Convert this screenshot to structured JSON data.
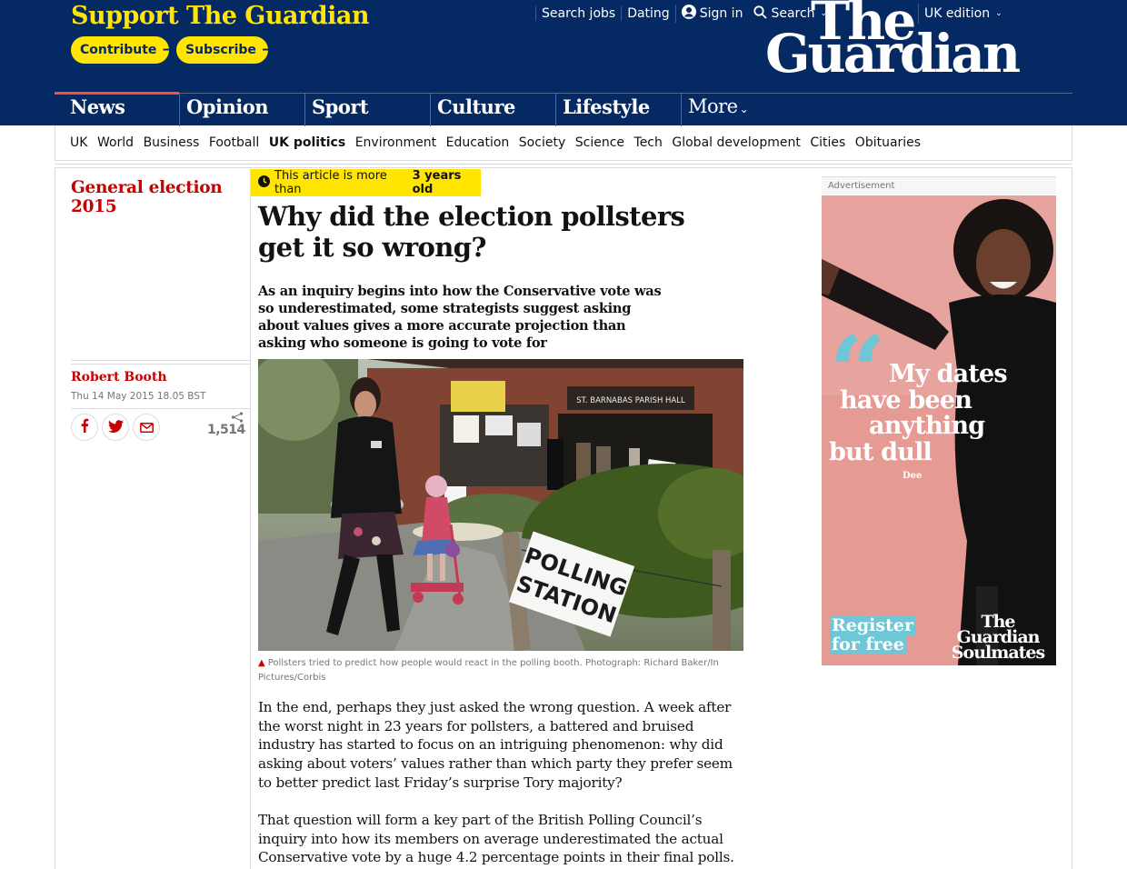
{
  "header": {
    "support_title": "Support The Guardian",
    "contribute_label": "Contribute",
    "subscribe_label": "Subscribe",
    "top_links": {
      "search_jobs": "Search jobs",
      "dating": "Dating",
      "sign_in": "Sign in",
      "search": "Search"
    },
    "edition": "UK edition",
    "logo_line1": "The",
    "logo_line2": "Guardian",
    "brand_color": "#052962",
    "support_color": "#ffe500",
    "news_accent": "#ff4e36"
  },
  "pillars": {
    "news": "News",
    "opinion": "Opinion",
    "sport": "Sport",
    "culture": "Culture",
    "lifestyle": "Lifestyle",
    "more": "More",
    "active": "News"
  },
  "subnav": {
    "items": [
      "UK",
      "World",
      "Business",
      "Football",
      "UK politics",
      "Environment",
      "Education",
      "Society",
      "Science",
      "Tech",
      "Global development",
      "Cities",
      "Obituaries"
    ],
    "active": "UK politics"
  },
  "article": {
    "section": "General election 2015",
    "age_notice_prefix": "This article is more than",
    "age_notice_bold": "3 years old",
    "headline": "Why did the election pollsters get it so wrong?",
    "standfirst": "As an inquiry begins into how the Conservative vote was so underestimated, some strategists suggest asking about values gives a more accurate projection than asking who someone is going to vote for",
    "byline": "Robert Booth",
    "dateline": "Thu 14 May 2015 18.05 BST",
    "share_count": "1,514",
    "photo_signs": {
      "hall": "ST. BARNABAS PARISH HALL",
      "polling_line1": "POLLING",
      "polling_line2": "STATION"
    },
    "caption": "Pollsters tried to predict how people would react in the polling booth. Photograph: Richard Baker/In Pictures/Corbis",
    "paragraphs": [
      "In the end, perhaps they just asked the wrong question. A week after the worst night in 23 years for pollsters, a battered and bruised industry has started to focus on an intriguing phenomenon: why did asking about voters’ values rather than which party they prefer seem to better predict last Friday’s surprise Tory majority?",
      "That question will form a key part of the British Polling Council’s inquiry into how its members on average underestimated the actual Conservative vote by a huge 4.2 percentage points in their final polls."
    ],
    "section_color": "#c70000"
  },
  "ad": {
    "label": "Advertisement",
    "quote_mark": "“",
    "quote_line1": "My dates",
    "quote_line2": "have been",
    "quote_line3": "anything",
    "quote_line4": "but dull",
    "attribution": "Dee",
    "register_line1": "Register",
    "register_line2": "for free",
    "brand_line1": "The",
    "brand_line2": "Guardian",
    "brand_line3": "Soulmates",
    "background": "#e59a94",
    "accent": "#6fc7d6"
  },
  "icons": {
    "user": "user-icon",
    "search": "search-icon",
    "clock": "clock-icon",
    "facebook": "facebook-icon",
    "twitter": "twitter-icon",
    "email": "email-icon",
    "share": "share-icon",
    "caption": "triangle-icon"
  }
}
